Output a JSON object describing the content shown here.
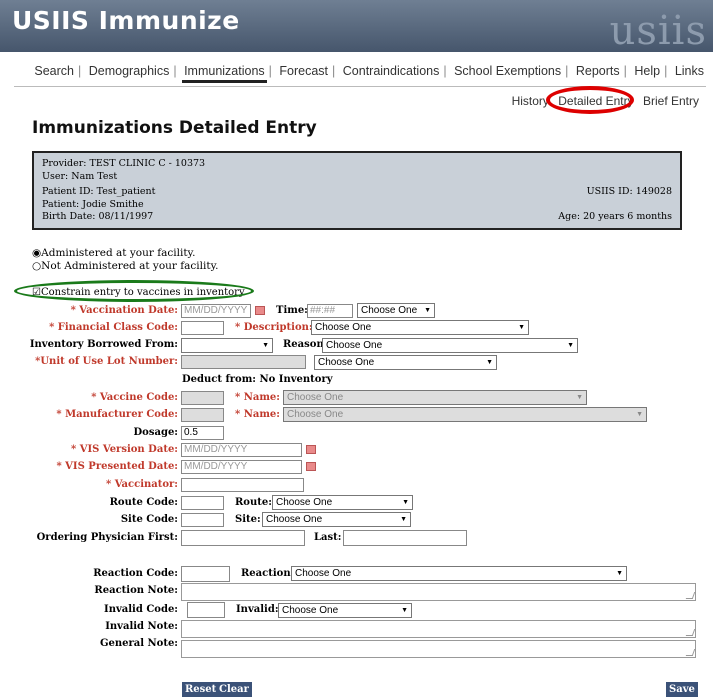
{
  "header": {
    "app_title": "USIIS Immunize",
    "logo": "usiis"
  },
  "nav": [
    "Search",
    "Demographics",
    "Immunizations",
    "Forecast",
    "Contraindications",
    "School Exemptions",
    "Reports",
    "Help",
    "Links"
  ],
  "subnav": [
    "History",
    "Detailed Entry",
    "Brief Entry"
  ],
  "page_title": "Immunizations Detailed Entry",
  "info": {
    "provider": "Provider: TEST CLINIC C - 10373",
    "user": "User: Nam Test",
    "patient_id": "Patient ID: Test_patient",
    "patient": "Patient: Jodie Smithe",
    "birth_date": "Birth Date: 08/11/1997",
    "usiis_id": "USIIS ID: 149028",
    "age": "Age: 20 years 6 months"
  },
  "radios": {
    "administered": "Administered at your facility.",
    "not_administered": "Not Administered at your facility.",
    "constrain": "Constrain entry to vaccines in inventory"
  },
  "form": {
    "vaccination_date_label": "* Vaccination Date:",
    "vaccination_date_ph": "MM/DD/YYYY",
    "time_label": "Time:",
    "time_ph": "##:##",
    "time_select": "Choose One",
    "financial_class_label": "* Financial Class Code:",
    "description_label": "* Description:",
    "description_select": "Choose One",
    "inventory_borrowed_label": "Inventory Borrowed From:",
    "reason_label": "Reason:",
    "reason_select": "Choose One",
    "lot_number_label": "*Unit of Use Lot Number:",
    "lot_select": "Choose One",
    "deduct_from": "Deduct from: No Inventory",
    "vaccine_code_label": "* Vaccine Code:",
    "vaccine_name_label": "* Name:",
    "vaccine_name_select": "Choose One",
    "manufacturer_code_label": "* Manufacturer Code:",
    "manufacturer_name_label": "* Name:",
    "manufacturer_name_select": "Choose One",
    "dosage_label": "Dosage:",
    "dosage_value": "0.5",
    "vis_version_label": "* VIS Version Date:",
    "vis_version_ph": "MM/DD/YYYY",
    "vis_presented_label": "* VIS Presented Date:",
    "vis_presented_ph": "MM/DD/YYYY",
    "vaccinator_label": "* Vaccinator:",
    "route_code_label": "Route Code:",
    "route_label": "Route:",
    "route_select": "Choose One",
    "site_code_label": "Site Code:",
    "site_label": "Site:",
    "site_select": "Choose One",
    "ordering_physician_label": "Ordering Physician First:",
    "last_label": "Last:",
    "reaction_code_label": "Reaction Code:",
    "reaction_label": "Reaction:",
    "reaction_select": "Choose One",
    "reaction_note_label": "Reaction Note:",
    "invalid_code_label": "Invalid Code:",
    "invalid_label": "Invalid:",
    "invalid_select": "Choose One",
    "invalid_note_label": "Invalid Note:",
    "general_note_label": "General Note:"
  },
  "buttons": {
    "reset": "Reset",
    "clear": "Clear",
    "save": "Save"
  },
  "colors": {
    "required": "#c0392b",
    "button": "#3b5278",
    "highlight_red": "#dd0000",
    "highlight_green": "#1a7a1a"
  }
}
